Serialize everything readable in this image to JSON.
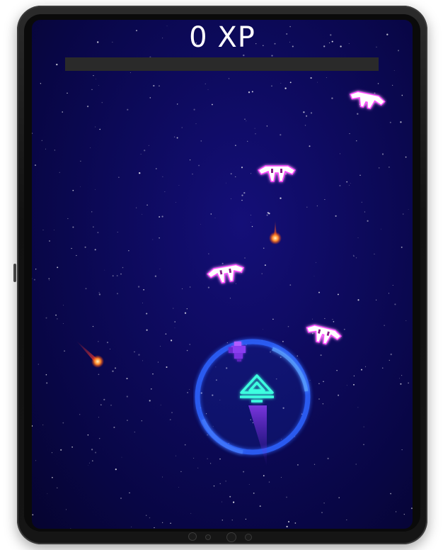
{
  "hud": {
    "xp_label": "0 XP",
    "xp_progress": 0
  },
  "colors": {
    "space": "#0d0a5c",
    "enemy": "#ffffff",
    "enemy_glow": "#ff3cff",
    "player": "#3cffe0",
    "shield": "#2d63ff",
    "projectile": "#ff7a2a",
    "xp_bar_track": "#2a2a2a"
  },
  "entities": {
    "enemies": [
      "alien-ship",
      "alien-ship",
      "alien-ship",
      "alien-ship"
    ],
    "projectiles": [
      "fireball",
      "fireball"
    ],
    "player": "triangle-ship",
    "shield": "energy-ring",
    "pickup": "purple-gem"
  }
}
